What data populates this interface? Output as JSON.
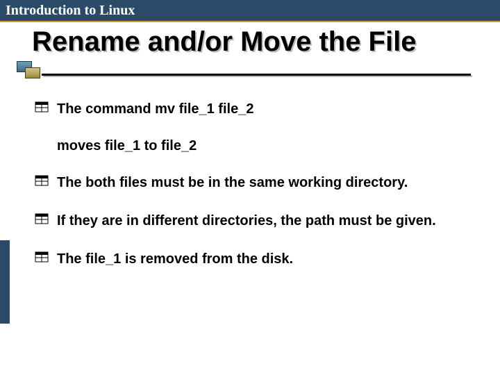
{
  "header": {
    "text": "Introduction to Linux"
  },
  "title": "Rename and/or Move the File",
  "bullets": {
    "b1_line1": "The command mv file_1 file_2",
    "b1_line2": "moves file_1 to file_2",
    "b2": "The both files must be in the same working directory.",
    "b3": " If they are in different directories, the path must be given.",
    "b4": "The file_1 is removed from the disk."
  }
}
